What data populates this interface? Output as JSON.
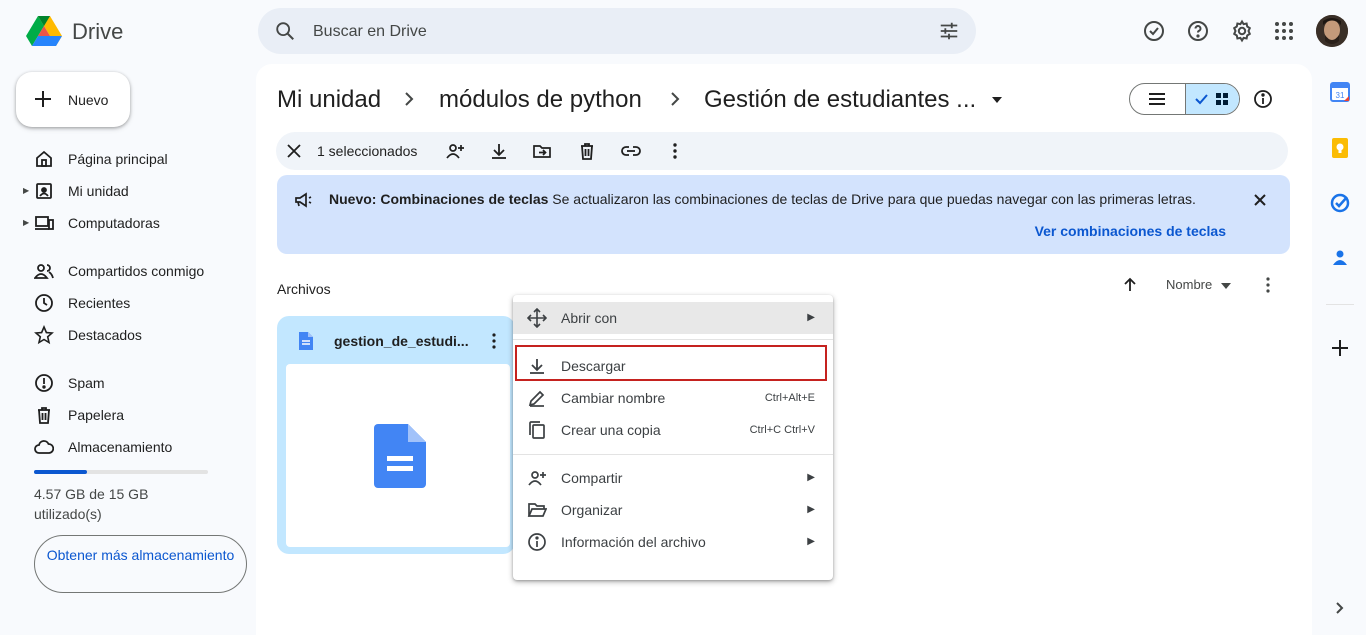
{
  "app": {
    "name": "Drive"
  },
  "search": {
    "placeholder": "Buscar en Drive"
  },
  "sidebar": {
    "new_label": "Nuevo",
    "items": [
      {
        "label": "Página principal",
        "icon": "home-icon"
      },
      {
        "label": "Mi unidad",
        "icon": "drive-icon"
      },
      {
        "label": "Computadoras",
        "icon": "computer-icon"
      },
      {
        "label": "Compartidos conmigo",
        "icon": "people-icon"
      },
      {
        "label": "Recientes",
        "icon": "clock-icon"
      },
      {
        "label": "Destacados",
        "icon": "star-icon"
      },
      {
        "label": "Spam",
        "icon": "spam-icon"
      },
      {
        "label": "Papelera",
        "icon": "trash-icon"
      },
      {
        "label": "Almacenamiento",
        "icon": "cloud-icon"
      }
    ],
    "storage_text": "4.57 GB de 15 GB utilizado(s)",
    "storage_fraction": 0.305,
    "get_more": "Obtener más almacenamiento"
  },
  "breadcrumb": {
    "root": "Mi unidad",
    "middle": "módulos de python",
    "current": "Gestión de estudiantes ..."
  },
  "selection": {
    "count_label": "1 seleccionados"
  },
  "banner": {
    "bold": "Nuevo: Combinaciones de teclas",
    "text": " Se actualizaron las combinaciones de teclas de Drive para que puedas navegar con las primeras letras.",
    "link": "Ver combinaciones de teclas"
  },
  "files": {
    "section_label": "Archivos",
    "sort_label": "Nombre",
    "card_name": "gestion_de_estudi..."
  },
  "context_menu": {
    "items": [
      {
        "label": "Abrir con",
        "shortcut": "",
        "submenu": true
      },
      {
        "label": "Descargar",
        "shortcut": "",
        "submenu": false
      },
      {
        "label": "Cambiar nombre",
        "shortcut": "Ctrl+Alt+E",
        "submenu": false
      },
      {
        "label": "Crear una copia",
        "shortcut": "Ctrl+C Ctrl+V",
        "submenu": false
      },
      {
        "label": "Compartir",
        "shortcut": "",
        "submenu": true
      },
      {
        "label": "Organizar",
        "shortcut": "",
        "submenu": true
      },
      {
        "label": "Información del archivo",
        "shortcut": "",
        "submenu": true
      }
    ]
  },
  "colors": {
    "accent": "#0b57d0",
    "selected": "#c2e7ff",
    "banner": "#d3e3fd",
    "highlight_border": "#c5221f"
  }
}
